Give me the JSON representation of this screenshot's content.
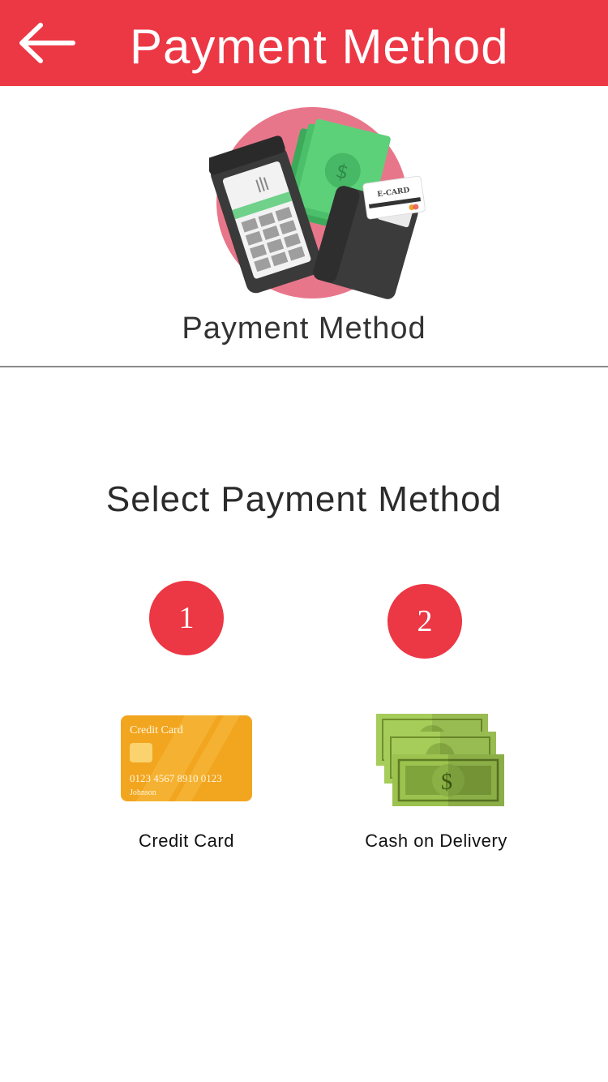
{
  "header": {
    "title": "Payment Method",
    "back_icon": "arrow-left-icon",
    "background_color": "#ec3744"
  },
  "hero": {
    "illustration_icon": "payment-terminal-wallet-icon",
    "ecard_text": "E-CARD",
    "title": "Payment Method"
  },
  "select": {
    "title": "Select Payment Method"
  },
  "options": [
    {
      "number": "1",
      "icon": "credit-card-icon",
      "label": "Credit Card",
      "card_title": "Credit Card",
      "card_number": "0123 4567 8910 0123",
      "card_holder": "Johnson"
    },
    {
      "number": "2",
      "icon": "cash-banknotes-icon",
      "label": "Cash on Delivery"
    }
  ]
}
